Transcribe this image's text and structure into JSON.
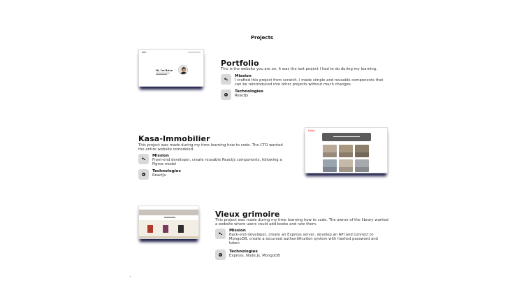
{
  "section": {
    "title": "Projects"
  },
  "labels": {
    "mission": "Mission",
    "technologies": "Technologies"
  },
  "projects": [
    {
      "title": "Portfolio",
      "description": "This is the website you are on, it was the last project I had to do during my learning.",
      "mission": "I crafted this project from scratch. I made simple and reusable components that can be reintroduced into other projects without much changes.",
      "technologies": "ReactJs",
      "preview": {
        "greeting": "Hi, I'm Brice"
      }
    },
    {
      "title": "Kasa-Immobilier",
      "description": "This project was made during my time learning how to code. The CTO wanted the entire website remodeled",
      "mission": "Front-end developer, create reusable ReactJs components, following a Figma model",
      "technologies": "ReactJs",
      "preview": {
        "logo": "Kasa"
      }
    },
    {
      "title": "Vieux grimoire",
      "description": "This project was made during my time learning how to code. The owner of the library wanted a website where users could add books and rate them.",
      "mission": "Back-end developer, create an Express server, develop an API and connect to MongoDB, create a secursed authentification system with hashed password and token",
      "technologies": "Express, Node.Js, MongoDB",
      "preview": {}
    }
  ],
  "icons": {
    "mission": "gear-icon",
    "technologies": "globe-icon"
  },
  "colors": {
    "shadow": "#1e1f4a",
    "icon_bg": "#d9d9d9",
    "kasa_red": "#ff6060"
  }
}
